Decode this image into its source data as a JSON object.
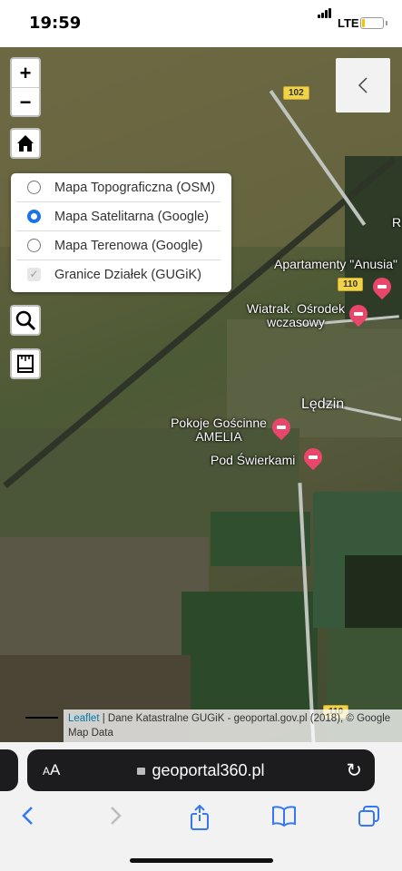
{
  "status_bar": {
    "time": "19:59",
    "network": "LTE",
    "battery_level": 0.15
  },
  "map": {
    "road_numbers": [
      "102",
      "110",
      "110"
    ],
    "places": [
      "R",
      "Apartamenty \"Anusia\"",
      "Wiatrak. Ośrodek wczasowy",
      "Lędzin",
      "Pokoje Gościnne AMELIA",
      "Pod Świerkami"
    ],
    "controls": {
      "zoom_in": "+",
      "zoom_out": "−",
      "back_icon": "chevron-left"
    },
    "layers": [
      {
        "label": "Mapa Topograficzna (OSM)",
        "type": "radio",
        "selected": false
      },
      {
        "label": "Mapa Satelitarna (Google)",
        "type": "radio",
        "selected": true
      },
      {
        "label": "Mapa Terenowa (Google)",
        "type": "radio",
        "selected": false
      },
      {
        "label": "Granice Działek (GUGiK)",
        "type": "checkbox",
        "checked": true
      }
    ],
    "attribution": {
      "leaflet": "Leaflet",
      "text": " | Dane Katastralne GUGiK - geoportal.gov.pl (2018), © Google Map Data"
    }
  },
  "browser": {
    "text_size_small": "A",
    "text_size_large": "A",
    "url": "geoportal360.pl",
    "accent": "#3478f6"
  }
}
